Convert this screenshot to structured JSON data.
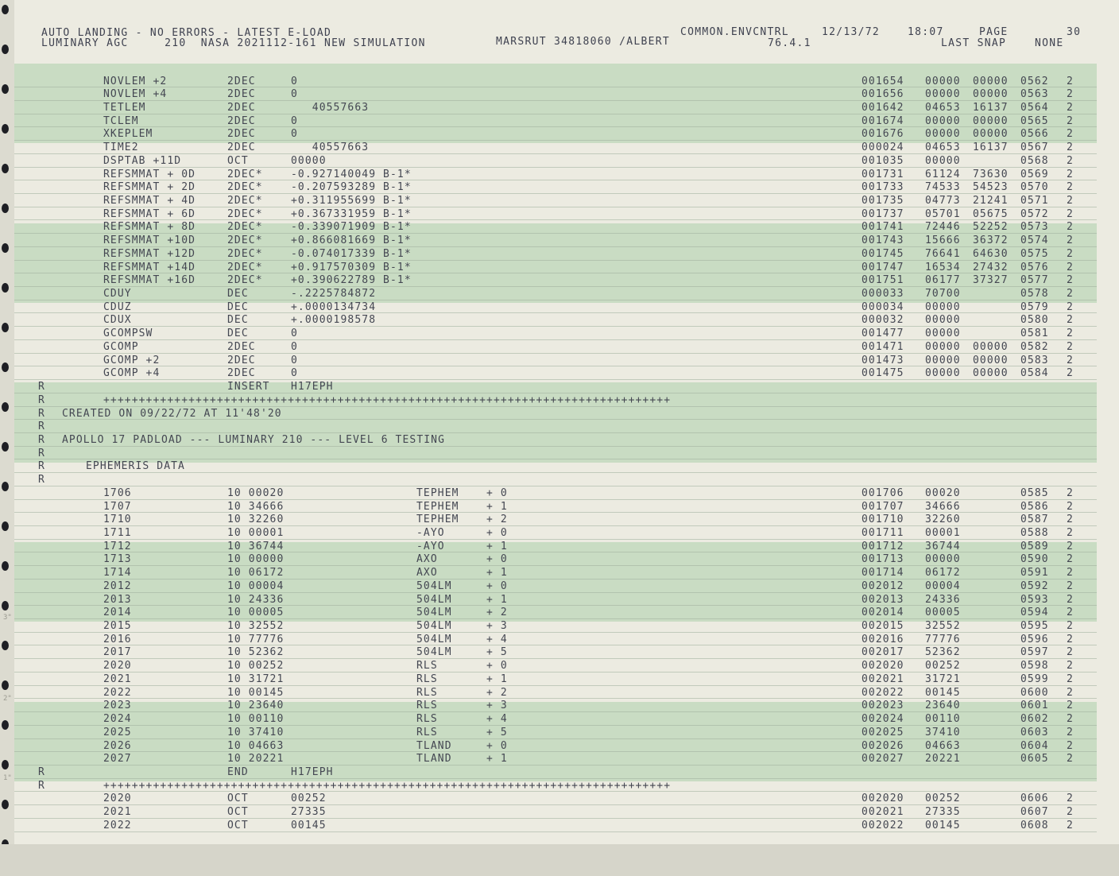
{
  "header": {
    "line1_left": "AUTO LANDING - NO ERRORS - LATEST E-LOAD",
    "line2_left": "LUMINARY AGC     210  NASA 2021112-161 NEW SIMULATION",
    "line2_mid": "MARSRUT 34818060 /ALBERT",
    "line1_right_a": "COMMON.ENVCNTRL",
    "line1_right_b": "12/13/72",
    "line1_right_c": "18:07",
    "line1_right_d": "PAGE",
    "page_number": "30",
    "line2_right_a": "76.4.1",
    "line2_right_b": "LAST SNAP",
    "line2_right_c": "NONE"
  },
  "margin_marks": [
    "3\"",
    "2\"",
    "1\""
  ],
  "rows": [
    {
      "sym": "NOVLEM +2",
      "type": "2DEC",
      "val": "0",
      "op": "",
      "idx": "",
      "addr": "001654",
      "w1": "00000",
      "w2": "00000",
      "seq": "0562",
      "flag": "2"
    },
    {
      "sym": "NOVLEM +4",
      "type": "2DEC",
      "val": "0",
      "op": "",
      "idx": "",
      "addr": "001656",
      "w1": "00000",
      "w2": "00000",
      "seq": "0563",
      "flag": "2"
    },
    {
      "sym": "TETLEM",
      "type": "2DEC",
      "val": "   40557663",
      "op": "",
      "idx": "",
      "addr": "001642",
      "w1": "04653",
      "w2": "16137",
      "seq": "0564",
      "flag": "2"
    },
    {
      "sym": "TCLEM",
      "type": "2DEC",
      "val": "0",
      "op": "",
      "idx": "",
      "addr": "001674",
      "w1": "00000",
      "w2": "00000",
      "seq": "0565",
      "flag": "2"
    },
    {
      "sym": "XKEPLEM",
      "type": "2DEC",
      "val": "0",
      "op": "",
      "idx": "",
      "addr": "001676",
      "w1": "00000",
      "w2": "00000",
      "seq": "0566",
      "flag": "2"
    },
    {
      "sym": "TIME2",
      "type": "2DEC",
      "val": "   40557663",
      "op": "",
      "idx": "",
      "addr": "000024",
      "w1": "04653",
      "w2": "16137",
      "seq": "0567",
      "flag": "2"
    },
    {
      "sym": "DSPTAB +11D",
      "type": "OCT",
      "val": "00000",
      "op": "",
      "idx": "",
      "addr": "001035",
      "w1": "00000",
      "w2": "",
      "seq": "0568",
      "flag": "2"
    },
    {
      "sym": "REFSMMAT + 0D",
      "type": "2DEC*",
      "val": "-0.927140049 B-1*",
      "op": "",
      "idx": "",
      "addr": "001731",
      "w1": "61124",
      "w2": "73630",
      "seq": "0569",
      "flag": "2"
    },
    {
      "sym": "REFSMMAT + 2D",
      "type": "2DEC*",
      "val": "-0.207593289 B-1*",
      "op": "",
      "idx": "",
      "addr": "001733",
      "w1": "74533",
      "w2": "54523",
      "seq": "0570",
      "flag": "2"
    },
    {
      "sym": "REFSMMAT + 4D",
      "type": "2DEC*",
      "val": "+0.311955699 B-1*",
      "op": "",
      "idx": "",
      "addr": "001735",
      "w1": "04773",
      "w2": "21241",
      "seq": "0571",
      "flag": "2"
    },
    {
      "sym": "REFSMMAT + 6D",
      "type": "2DEC*",
      "val": "+0.367331959 B-1*",
      "op": "",
      "idx": "",
      "addr": "001737",
      "w1": "05701",
      "w2": "05675",
      "seq": "0572",
      "flag": "2"
    },
    {
      "sym": "REFSMMAT + 8D",
      "type": "2DEC*",
      "val": "-0.339071909 B-1*",
      "op": "",
      "idx": "",
      "addr": "001741",
      "w1": "72446",
      "w2": "52252",
      "seq": "0573",
      "flag": "2"
    },
    {
      "sym": "REFSMMAT +10D",
      "type": "2DEC*",
      "val": "+0.866081669 B-1*",
      "op": "",
      "idx": "",
      "addr": "001743",
      "w1": "15666",
      "w2": "36372",
      "seq": "0574",
      "flag": "2"
    },
    {
      "sym": "REFSMMAT +12D",
      "type": "2DEC*",
      "val": "-0.074017339 B-1*",
      "op": "",
      "idx": "",
      "addr": "001745",
      "w1": "76641",
      "w2": "64630",
      "seq": "0575",
      "flag": "2"
    },
    {
      "sym": "REFSMMAT +14D",
      "type": "2DEC*",
      "val": "+0.917570309 B-1*",
      "op": "",
      "idx": "",
      "addr": "001747",
      "w1": "16534",
      "w2": "27432",
      "seq": "0576",
      "flag": "2"
    },
    {
      "sym": "REFSMMAT +16D",
      "type": "2DEC*",
      "val": "+0.390622789 B-1*",
      "op": "",
      "idx": "",
      "addr": "001751",
      "w1": "06177",
      "w2": "37327",
      "seq": "0577",
      "flag": "2"
    },
    {
      "sym": "CDUY",
      "type": "DEC",
      "val": "-.2225784872",
      "op": "",
      "idx": "",
      "addr": "000033",
      "w1": "70700",
      "w2": "",
      "seq": "0578",
      "flag": "2"
    },
    {
      "sym": "CDUZ",
      "type": "DEC",
      "val": "+.0000134734",
      "op": "",
      "idx": "",
      "addr": "000034",
      "w1": "00000",
      "w2": "",
      "seq": "0579",
      "flag": "2"
    },
    {
      "sym": "CDUX",
      "type": "DEC",
      "val": "+.0000198578",
      "op": "",
      "idx": "",
      "addr": "000032",
      "w1": "00000",
      "w2": "",
      "seq": "0580",
      "flag": "2"
    },
    {
      "sym": "GCOMPSW",
      "type": "DEC",
      "val": "0",
      "op": "",
      "idx": "",
      "addr": "001477",
      "w1": "00000",
      "w2": "",
      "seq": "0581",
      "flag": "2"
    },
    {
      "sym": "GCOMP",
      "type": "2DEC",
      "val": "0",
      "op": "",
      "idx": "",
      "addr": "001471",
      "w1": "00000",
      "w2": "00000",
      "seq": "0582",
      "flag": "2"
    },
    {
      "sym": "GCOMP +2",
      "type": "2DEC",
      "val": "0",
      "op": "",
      "idx": "",
      "addr": "001473",
      "w1": "00000",
      "w2": "00000",
      "seq": "0583",
      "flag": "2"
    },
    {
      "sym": "GCOMP +4",
      "type": "2DEC",
      "val": "0",
      "op": "",
      "idx": "",
      "addr": "001475",
      "w1": "00000",
      "w2": "00000",
      "seq": "0584",
      "flag": "2"
    },
    {
      "r": "R",
      "type": "INSERT",
      "val": "H17EPH"
    },
    {
      "r": "R",
      "plus": "++++++++++++++++++++++++++++++++++++++++++++++++++++++++++++++++++++++++++++++++"
    },
    {
      "r": "R",
      "text": "CREATED ON 09/22/72 AT 11'48'20"
    },
    {
      "r": "R"
    },
    {
      "r": "R",
      "text": "APOLLO 17 PADLOAD --- LUMINARY 210 --- LEVEL 6 TESTING"
    },
    {
      "r": "R"
    },
    {
      "r": "R",
      "text2": "EPHEMERIS DATA"
    },
    {
      "r": "R"
    },
    {
      "sym": "1706",
      "type": "10 00020",
      "val": "",
      "op": "TEPHEM",
      "idx": "+ 0",
      "addr": "001706",
      "w1": "00020",
      "w2": "",
      "seq": "0585",
      "flag": "2"
    },
    {
      "sym": "1707",
      "type": "10 34666",
      "val": "",
      "op": "TEPHEM",
      "idx": "+ 1",
      "addr": "001707",
      "w1": "34666",
      "w2": "",
      "seq": "0586",
      "flag": "2"
    },
    {
      "sym": "1710",
      "type": "10 32260",
      "val": "",
      "op": "TEPHEM",
      "idx": "+ 2",
      "addr": "001710",
      "w1": "32260",
      "w2": "",
      "seq": "0587",
      "flag": "2"
    },
    {
      "sym": "1711",
      "type": "10 00001",
      "val": "",
      "op": "-AYO",
      "idx": "+ 0",
      "addr": "001711",
      "w1": "00001",
      "w2": "",
      "seq": "0588",
      "flag": "2"
    },
    {
      "sym": "1712",
      "type": "10 36744",
      "val": "",
      "op": "-AYO",
      "idx": "+ 1",
      "addr": "001712",
      "w1": "36744",
      "w2": "",
      "seq": "0589",
      "flag": "2"
    },
    {
      "sym": "1713",
      "type": "10 00000",
      "val": "",
      "op": "AXO",
      "idx": "+ 0",
      "addr": "001713",
      "w1": "00000",
      "w2": "",
      "seq": "0590",
      "flag": "2"
    },
    {
      "sym": "1714",
      "type": "10 06172",
      "val": "",
      "op": "AXO",
      "idx": "+ 1",
      "addr": "001714",
      "w1": "06172",
      "w2": "",
      "seq": "0591",
      "flag": "2"
    },
    {
      "sym": "2012",
      "type": "10 00004",
      "val": "",
      "op": "504LM",
      "idx": "+ 0",
      "addr": "002012",
      "w1": "00004",
      "w2": "",
      "seq": "0592",
      "flag": "2"
    },
    {
      "sym": "2013",
      "type": "10 24336",
      "val": "",
      "op": "504LM",
      "idx": "+ 1",
      "addr": "002013",
      "w1": "24336",
      "w2": "",
      "seq": "0593",
      "flag": "2"
    },
    {
      "sym": "2014",
      "type": "10 00005",
      "val": "",
      "op": "504LM",
      "idx": "+ 2",
      "addr": "002014",
      "w1": "00005",
      "w2": "",
      "seq": "0594",
      "flag": "2"
    },
    {
      "sym": "2015",
      "type": "10 32552",
      "val": "",
      "op": "504LM",
      "idx": "+ 3",
      "addr": "002015",
      "w1": "32552",
      "w2": "",
      "seq": "0595",
      "flag": "2"
    },
    {
      "sym": "2016",
      "type": "10 77776",
      "val": "",
      "op": "504LM",
      "idx": "+ 4",
      "addr": "002016",
      "w1": "77776",
      "w2": "",
      "seq": "0596",
      "flag": "2"
    },
    {
      "sym": "2017",
      "type": "10 52362",
      "val": "",
      "op": "504LM",
      "idx": "+ 5",
      "addr": "002017",
      "w1": "52362",
      "w2": "",
      "seq": "0597",
      "flag": "2"
    },
    {
      "sym": "2020",
      "type": "10 00252",
      "val": "",
      "op": "RLS",
      "idx": "+ 0",
      "addr": "002020",
      "w1": "00252",
      "w2": "",
      "seq": "0598",
      "flag": "2"
    },
    {
      "sym": "2021",
      "type": "10 31721",
      "val": "",
      "op": "RLS",
      "idx": "+ 1",
      "addr": "002021",
      "w1": "31721",
      "w2": "",
      "seq": "0599",
      "flag": "2"
    },
    {
      "sym": "2022",
      "type": "10 00145",
      "val": "",
      "op": "RLS",
      "idx": "+ 2",
      "addr": "002022",
      "w1": "00145",
      "w2": "",
      "seq": "0600",
      "flag": "2"
    },
    {
      "sym": "2023",
      "type": "10 23640",
      "val": "",
      "op": "RLS",
      "idx": "+ 3",
      "addr": "002023",
      "w1": "23640",
      "w2": "",
      "seq": "0601",
      "flag": "2"
    },
    {
      "sym": "2024",
      "type": "10 00110",
      "val": "",
      "op": "RLS",
      "idx": "+ 4",
      "addr": "002024",
      "w1": "00110",
      "w2": "",
      "seq": "0602",
      "flag": "2"
    },
    {
      "sym": "2025",
      "type": "10 37410",
      "val": "",
      "op": "RLS",
      "idx": "+ 5",
      "addr": "002025",
      "w1": "37410",
      "w2": "",
      "seq": "0603",
      "flag": "2"
    },
    {
      "sym": "2026",
      "type": "10 04663",
      "val": "",
      "op": "TLAND",
      "idx": "+ 0",
      "addr": "002026",
      "w1": "04663",
      "w2": "",
      "seq": "0604",
      "flag": "2"
    },
    {
      "sym": "2027",
      "type": "10 20221",
      "val": "",
      "op": "TLAND",
      "idx": "+ 1",
      "addr": "002027",
      "w1": "20221",
      "w2": "",
      "seq": "0605",
      "flag": "2"
    },
    {
      "r": "R",
      "type": "END",
      "val": "H17EPH"
    },
    {
      "r": "R",
      "plus": "++++++++++++++++++++++++++++++++++++++++++++++++++++++++++++++++++++++++++++++++"
    },
    {
      "sym": "2020",
      "type": "OCT",
      "val": "00252",
      "op": "",
      "idx": "",
      "addr": "002020",
      "w1": "00252",
      "w2": "",
      "seq": "0606",
      "flag": "2"
    },
    {
      "sym": "2021",
      "type": "OCT",
      "val": "27335",
      "op": "",
      "idx": "",
      "addr": "002021",
      "w1": "27335",
      "w2": "",
      "seq": "0607",
      "flag": "2"
    },
    {
      "sym": "2022",
      "type": "OCT",
      "val": "00145",
      "op": "",
      "idx": "",
      "addr": "002022",
      "w1": "00145",
      "w2": "",
      "seq": "0608",
      "flag": "2"
    }
  ]
}
